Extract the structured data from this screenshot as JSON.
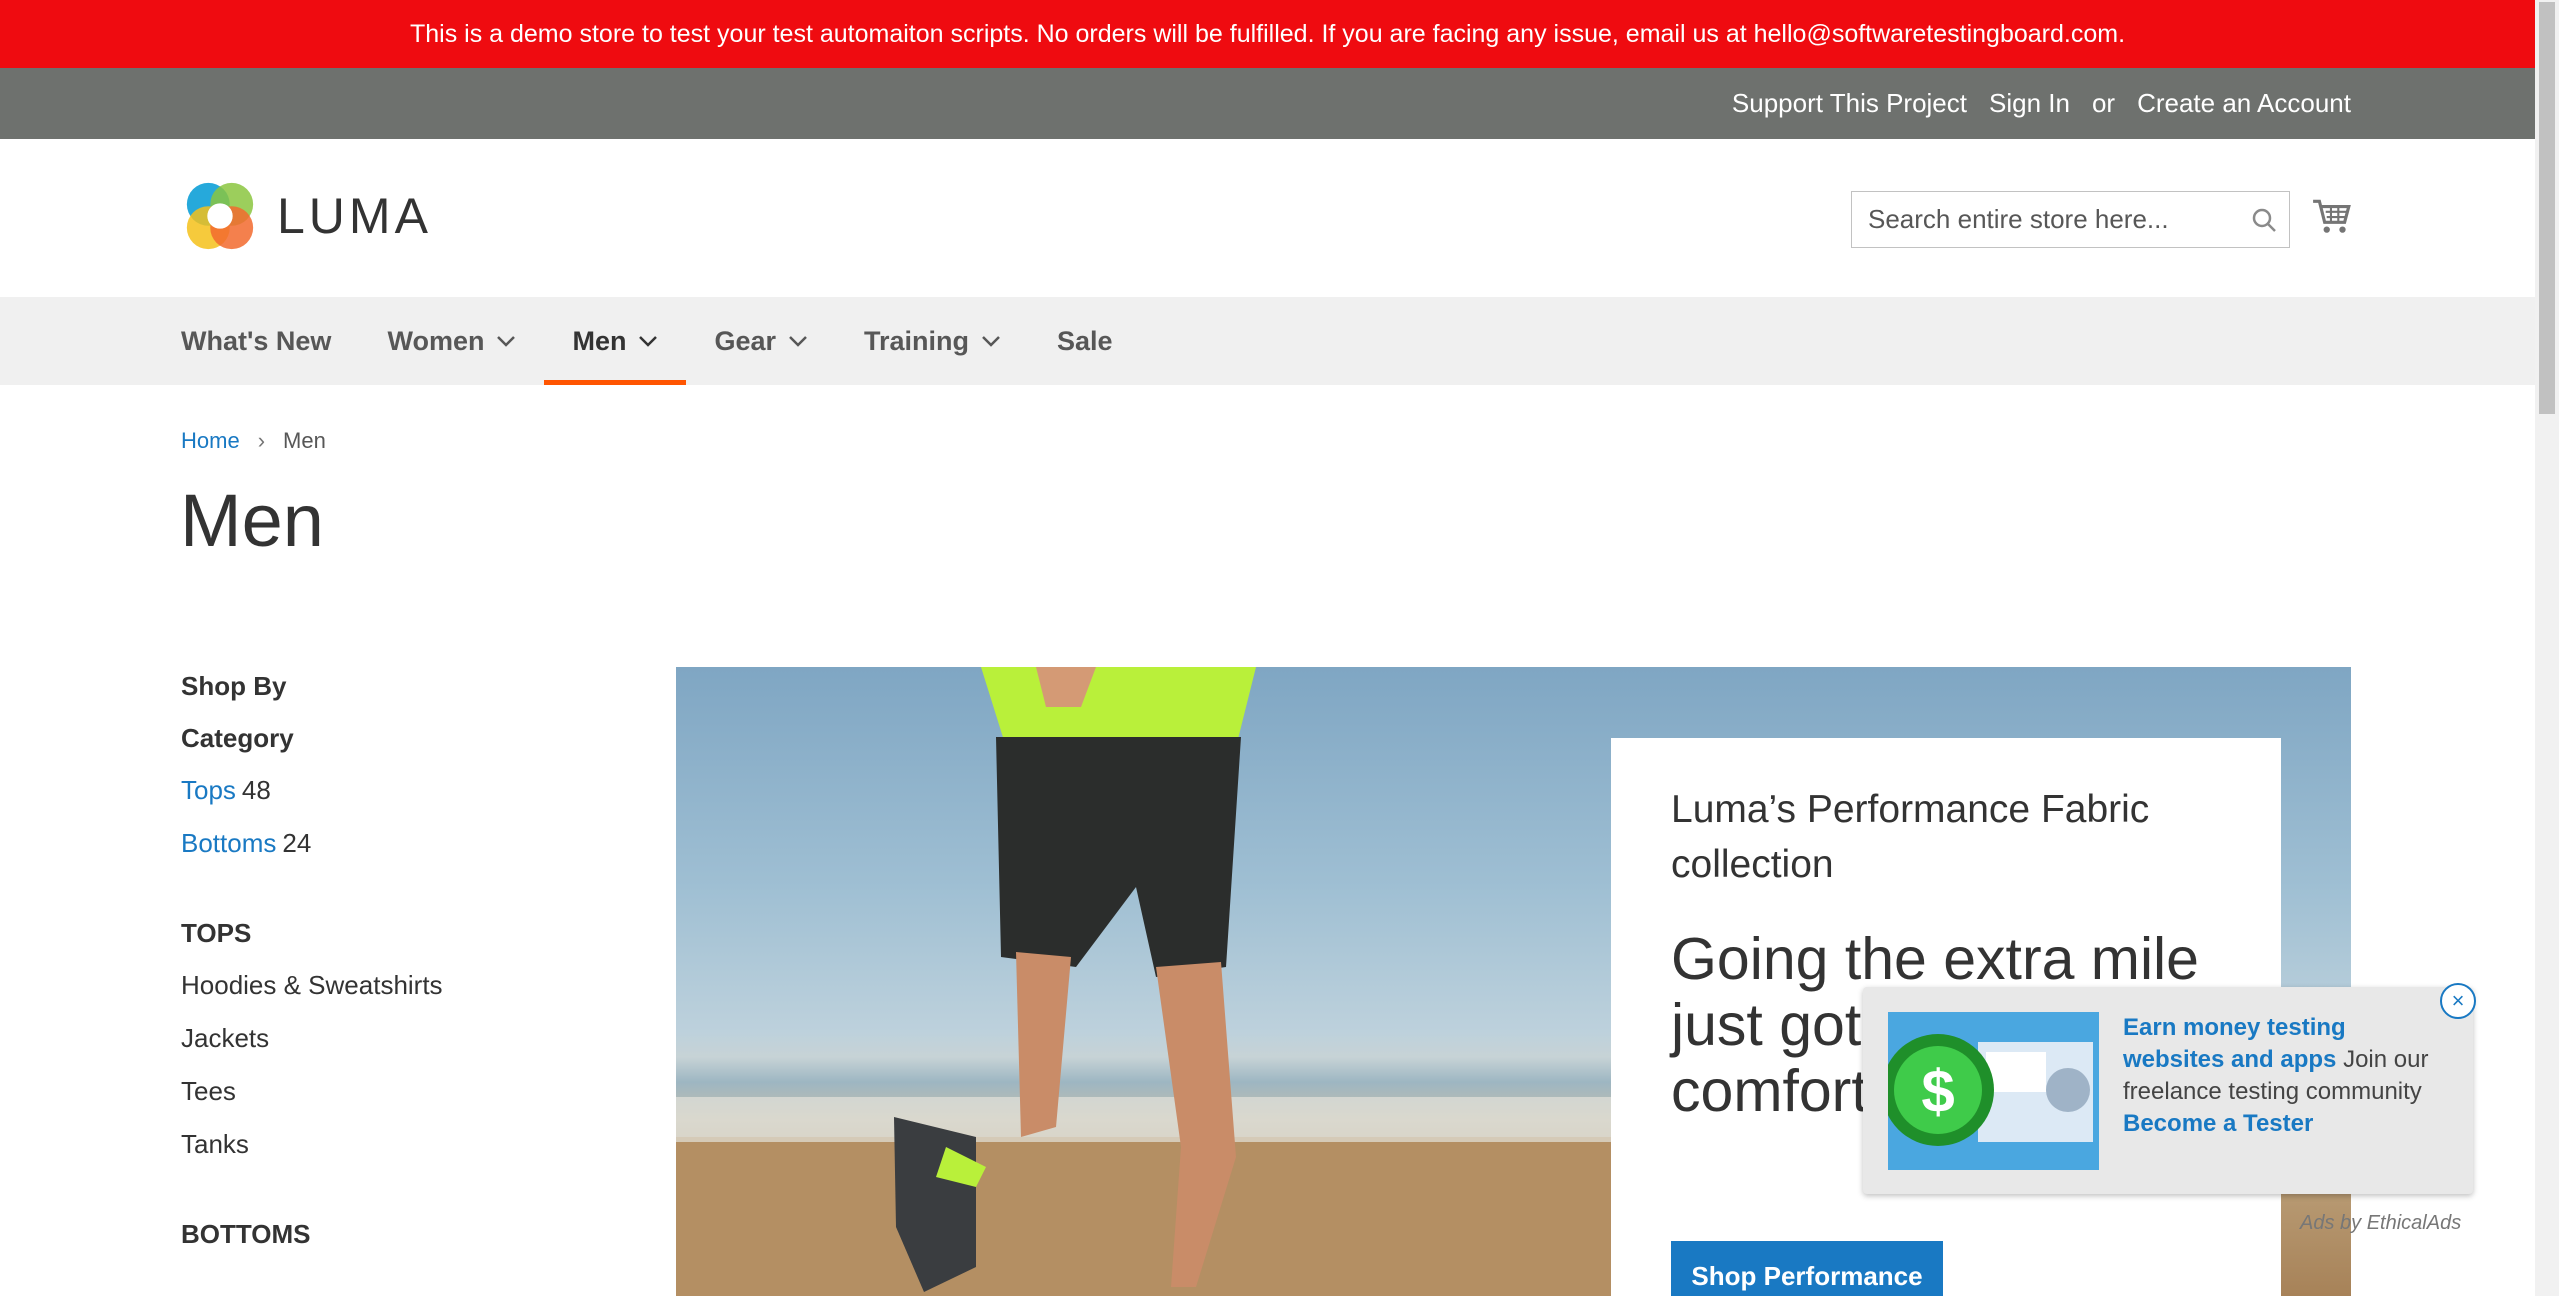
{
  "demo_banner": {
    "text": "This is a demo store to test your test automaiton scripts. No orders will be fulfilled. If you are facing any issue, email us at hello@softwaretestingboard.com."
  },
  "top_links": {
    "support": "Support This Project",
    "sign_in": "Sign In",
    "or": "or",
    "create_account": "Create an Account"
  },
  "header": {
    "logo_text": "LUMA",
    "search_placeholder": "Search entire store here..."
  },
  "nav": {
    "items": [
      {
        "label": "What's New",
        "dropdown": false
      },
      {
        "label": "Women",
        "dropdown": true
      },
      {
        "label": "Men",
        "dropdown": true,
        "active": true
      },
      {
        "label": "Gear",
        "dropdown": true
      },
      {
        "label": "Training",
        "dropdown": true
      },
      {
        "label": "Sale",
        "dropdown": false
      }
    ]
  },
  "breadcrumb": {
    "home": "Home",
    "separator": "›",
    "current": "Men"
  },
  "page_title": "Men",
  "sidebar": {
    "title": "Shop By",
    "subtitle": "Category",
    "categories": [
      {
        "label": "Tops",
        "count": "48"
      },
      {
        "label": "Bottoms",
        "count": "24"
      }
    ],
    "tops_heading": "TOPS",
    "tops_links": [
      "Hoodies & Sweatshirts",
      "Jackets",
      "Tees",
      "Tanks"
    ],
    "bottoms_heading": "BOTTOMS"
  },
  "hero": {
    "subtitle": "Luma’s Performance Fabric collection",
    "headline": "Going the extra mile just got more comfortable",
    "button": "Shop Performance"
  },
  "ad": {
    "highlight": "Earn money testing websites and apps",
    "body": " Join our freelance testing community ",
    "cta": "Become a Tester",
    "close": "×",
    "credit": "Ads by EthicalAds"
  },
  "colors": {
    "banner": "#ef0b10",
    "top_bar": "#6e716e",
    "nav_bg": "#f0f0f0",
    "accent": "#ff5501",
    "link": "#1979c3"
  }
}
